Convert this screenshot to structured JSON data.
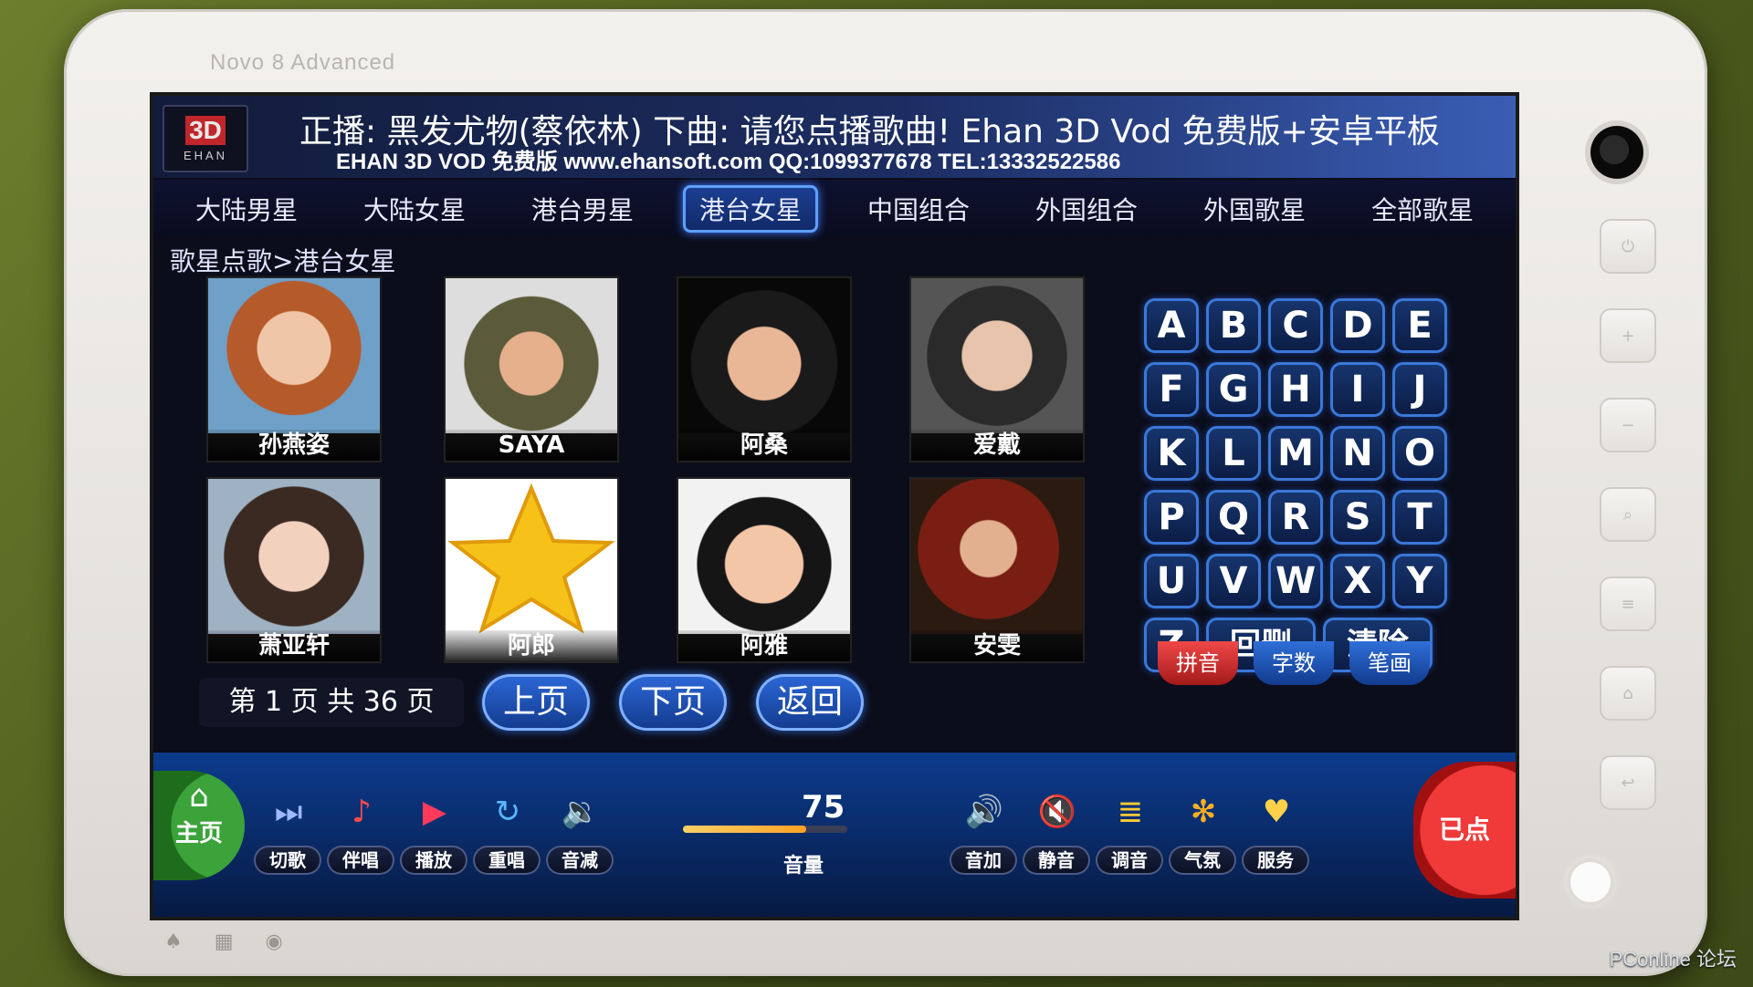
{
  "device": {
    "model_label": "Novo 8 Advanced"
  },
  "header": {
    "logo_top": "3D",
    "logo_bottom": "EHAN",
    "now_playing": "正播: 黑发尤物(蔡依林) 下曲: 请您点播歌曲! Ehan 3D Vod 免费版+安卓平板",
    "subline": "EHAN 3D VOD 免费版 www.ehansoft.com QQ:1099377678 TEL:13332522586"
  },
  "tabs": [
    "大陆男星",
    "大陆女星",
    "港台男星",
    "港台女星",
    "中国组合",
    "外国组合",
    "外国歌星",
    "全部歌星"
  ],
  "active_tab_index": 3,
  "breadcrumb": "歌星点歌>港台女星",
  "singers": [
    {
      "name": "孙燕姿",
      "thumb": "photo"
    },
    {
      "name": "SAYA",
      "thumb": "photo"
    },
    {
      "name": "阿桑",
      "thumb": "photo"
    },
    {
      "name": "爱戴",
      "thumb": "photo"
    },
    {
      "name": "萧亚轩",
      "thumb": "photo"
    },
    {
      "name": "阿郎",
      "thumb": "star-icon"
    },
    {
      "name": "阿雅",
      "thumb": "photo"
    },
    {
      "name": "安雯",
      "thumb": "photo"
    }
  ],
  "keypad": {
    "letters": [
      "A",
      "B",
      "C",
      "D",
      "E",
      "F",
      "G",
      "H",
      "I",
      "J",
      "K",
      "L",
      "M",
      "N",
      "O",
      "P",
      "Q",
      "R",
      "S",
      "T",
      "U",
      "V",
      "W",
      "X",
      "Y",
      "Z"
    ],
    "backspace": "回删",
    "clear": "清除",
    "modes": [
      "拼音",
      "字数",
      "笔画"
    ]
  },
  "pager": {
    "text": "第 1 页 共 36 页",
    "current": 1,
    "total": 36
  },
  "nav": {
    "prev": "上页",
    "next": "下页",
    "back": "返回"
  },
  "footer": {
    "home": "主页",
    "controls": [
      "切歌",
      "伴唱",
      "播放",
      "重唱",
      "音减"
    ],
    "volume_label": "音量",
    "volume_value": "75",
    "volume_level": 0.75,
    "controls_right": [
      "音加",
      "静音",
      "调音",
      "气氛",
      "服务"
    ],
    "selected": "已点"
  },
  "watermark": "PConline 论坛",
  "colors": {
    "accent": "#3b78d8",
    "selected": "#f03a3a",
    "home": "#3ba33a"
  }
}
